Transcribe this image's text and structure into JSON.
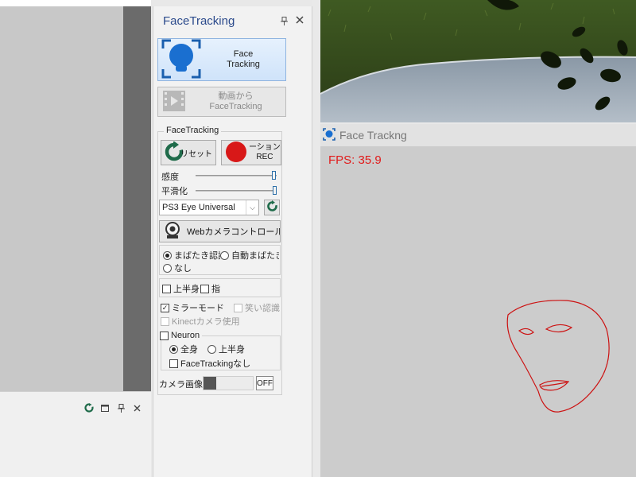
{
  "panel": {
    "title": "FaceTracking",
    "pin_glyph": "†",
    "close_glyph": "✕"
  },
  "buttons": {
    "face_tracking": "Face\nTracking",
    "from_video": "動画から\nFaceTracking",
    "reset": "リセット",
    "motion_rec": "ーション\nREC",
    "webcam_control": "Webカメラコントロール"
  },
  "group": {
    "legend": "FaceTracking"
  },
  "sliders": {
    "sensitivity_label": "感度",
    "sensitivity_value": 0.97,
    "smoothing_label": "平滑化",
    "smoothing_value": 0.98
  },
  "camera_select": {
    "selected": "PS3 Eye Universal"
  },
  "blink": {
    "options": [
      "まばたき認識",
      "自動まばたき",
      "なし"
    ],
    "selected_index": 0
  },
  "checks": {
    "upper_body": "上半身",
    "fingers": "指",
    "mirror_mode": "ミラーモード",
    "smile": "笑い認識",
    "kinect": "Kinectカメラ使用",
    "mirror_checked": true
  },
  "neuron": {
    "label": "Neuron",
    "options": [
      "全身",
      "上半身"
    ],
    "selected_index": 0,
    "no_facetracking": "FaceTrackingなし"
  },
  "camera_image": {
    "label": "カメラ画像",
    "state": "OFF"
  },
  "preview": {
    "title": "Face Trackng",
    "fps_text": "FPS: 35.9"
  },
  "colors": {
    "accent": "#2b6ea8",
    "rec_red": "#d81818",
    "refresh_green": "#1f6b4a",
    "fps_red": "#e11b1b",
    "face_outline": "#cc1111"
  }
}
